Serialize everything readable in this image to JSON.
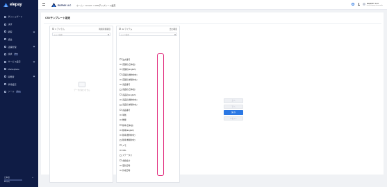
{
  "sidebar": {
    "logo": "elepay",
    "items": [
      {
        "label": "ダッシュボード",
        "icon": "dashboard-icon",
        "chevron": false,
        "badge": ""
      },
      {
        "label": "決済",
        "icon": "payment-icon",
        "chevron": false,
        "badge": ""
      },
      {
        "label": "顧客",
        "icon": "customer-icon",
        "chevron": true,
        "badge": ""
      },
      {
        "label": "返金",
        "icon": "refund-icon",
        "chevron": false,
        "badge": ""
      },
      {
        "label": "店舗管理",
        "icon": "store-icon",
        "chevron": true,
        "badge": ""
      },
      {
        "label": "請求",
        "icon": "invoice-icon",
        "chevron": false,
        "badge": "New"
      },
      {
        "label": "サービス設定",
        "icon": "settings-icon",
        "chevron": true,
        "badge": ""
      },
      {
        "label": "Marketplace",
        "icon": "marketplace-icon",
        "chevron": false,
        "badge": ""
      },
      {
        "label": "開発者",
        "icon": "developer-icon",
        "chevron": true,
        "badge": ""
      },
      {
        "label": "情報設定",
        "icon": "info-icon",
        "chevron": false,
        "badge": ""
      },
      {
        "label": "ツール",
        "icon": "tool-icon",
        "chevron": false,
        "badge": "Beta"
      }
    ],
    "language": "日本語",
    "account_label": "Elepay"
  },
  "topbar": {
    "company": "ELEPAY LLC",
    "breadcrumb": [
      "ホーム",
      "Growth",
      "CSVテンプレート設定"
    ],
    "user_name": "ELEPAY LLC",
    "user_email": "info@elepay.io/example"
  },
  "page": {
    "title": "CSVテンプレート設定"
  },
  "transfer": {
    "left": {
      "count_label": "0 アイテム",
      "title": "利用可能項目",
      "search_placeholder": "ここで検索",
      "empty_text": "データがありません"
    },
    "right": {
      "count_label": "22 アイテム",
      "title": "出力項目",
      "search_placeholder": "ここで検索",
      "items": [
        "注文番号",
        "店舗名(日本語)",
        "店舗名(English)",
        "店舗名(簡体中文)",
        "店舗名(繁體中文)",
        "商品番号",
        "商品名(日本語)",
        "商品名(English)",
        "商品名(簡体中文)",
        "商品名(繁體中文)",
        "商品番号",
        "単価",
        "数量",
        "税率(日本語)",
        "税率(English)",
        "税率(簡体中文)",
        "税率(繁體中文)",
        "メモ",
        "URL",
        "ステータス",
        "金額合計",
        "更新日時",
        "作成日時"
      ]
    },
    "actions": [
      "上へ",
      "下へ",
      "保 存",
      "リセット"
    ]
  },
  "colors": {
    "sidebar_bg": "#0f1c45",
    "accent": "#2b78e4",
    "highlight": "#e0287a"
  }
}
